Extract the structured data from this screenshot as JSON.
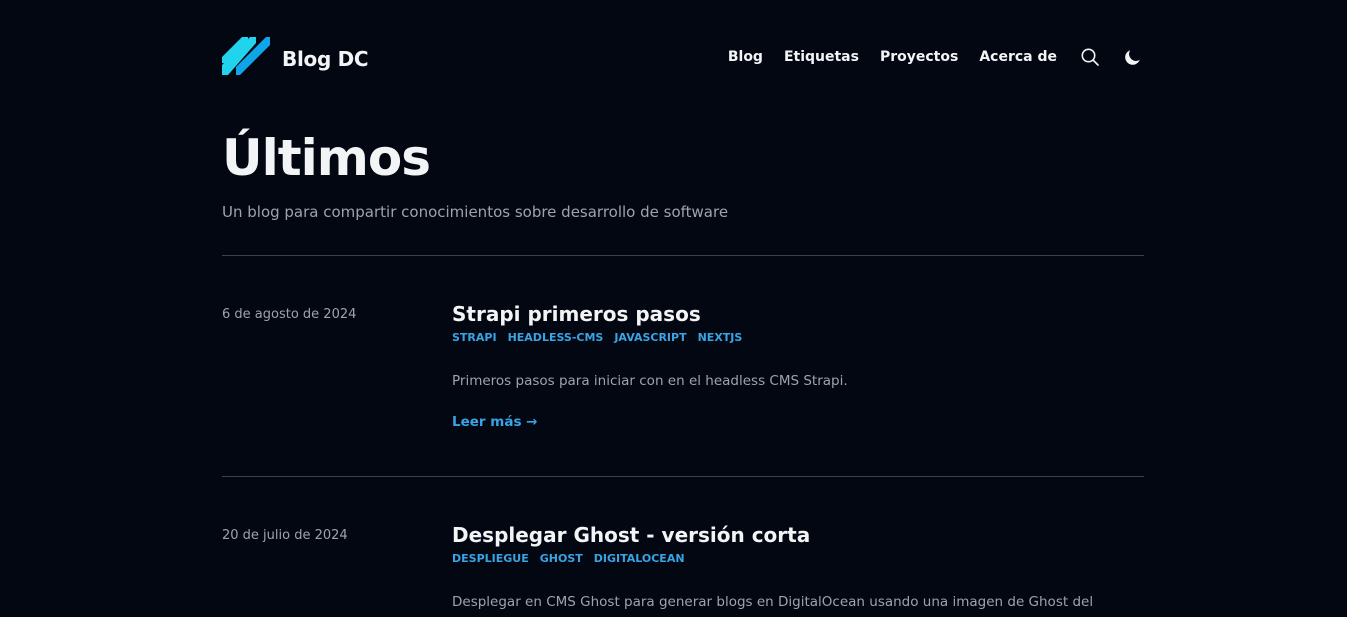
{
  "header": {
    "site_name": "Blog DC",
    "nav": [
      "Blog",
      "Etiquetas",
      "Proyectos",
      "Acerca de"
    ],
    "icons": [
      "search-icon",
      "moon-icon"
    ],
    "accent": "#38bdf8",
    "logo_colors": [
      "#22d3ee",
      "#0ea5e9"
    ]
  },
  "hero": {
    "title": "Últimos",
    "subtitle": "Un blog para compartir conocimientos sobre desarrollo de software"
  },
  "posts": [
    {
      "date": "6 de agosto de 2024",
      "title": "Strapi primeros pasos",
      "tags": [
        "STRAPI",
        "HEADLESS-CMS",
        "JAVASCRIPT",
        "NEXTJS"
      ],
      "summary": "Primeros pasos para iniciar con en el headless CMS Strapi.",
      "read_more": "Leer más →"
    },
    {
      "date": "20 de julio de 2024",
      "title": "Desplegar Ghost - versión corta",
      "tags": [
        "DESPLIEGUE",
        "GHOST",
        "DIGITALOCEAN"
      ],
      "summary": "Desplegar en CMS Ghost para generar blogs en DigitalOcean usando una imagen de Ghost del"
    }
  ],
  "colors": {
    "background": "#030712",
    "text": "#f3f4f6",
    "muted": "#9ca3af",
    "link": "#38a4e6",
    "divider": "#374151"
  }
}
